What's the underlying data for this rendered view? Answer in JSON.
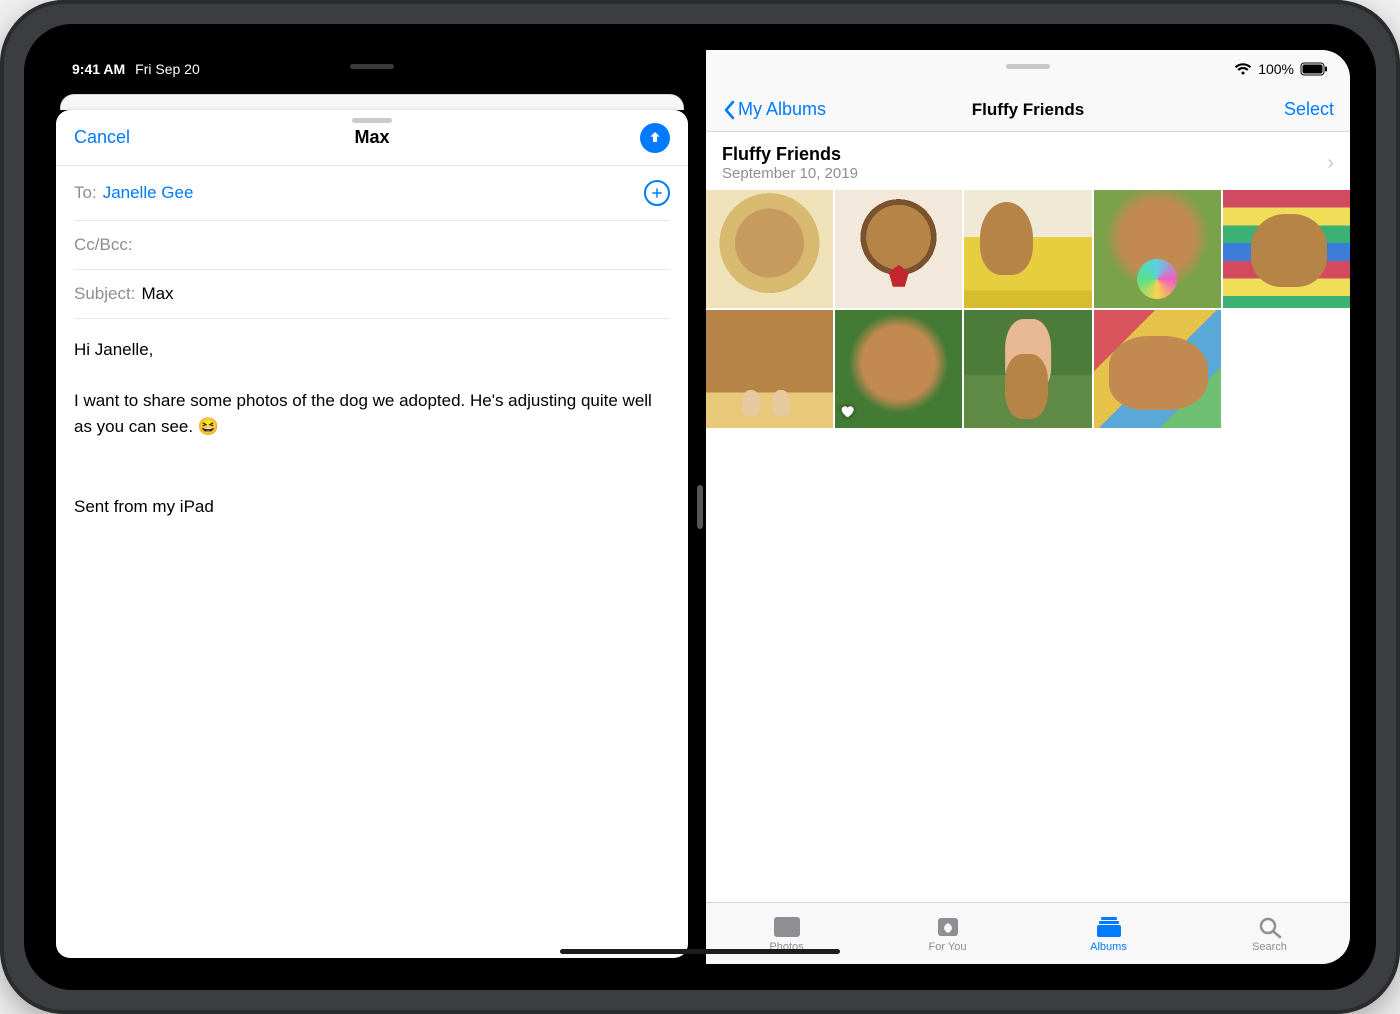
{
  "status": {
    "time": "9:41 AM",
    "date": "Fri Sep 20",
    "battery": "100%"
  },
  "mail": {
    "cancel": "Cancel",
    "title": "Max",
    "to_label": "To:",
    "to_value": "Janelle Gee",
    "ccbcc_label": "Cc/Bcc:",
    "subject_label": "Subject:",
    "subject_value": "Max",
    "body": "Hi Janelle,\n\nI want to share some photos of the dog we adopted. He's adjusting quite well as you can see. 😆",
    "signature": "Sent from my iPad"
  },
  "photos": {
    "back_label": "My Albums",
    "title": "Fluffy Friends",
    "select": "Select",
    "album": {
      "name": "Fluffy Friends",
      "date": "September 10, 2019"
    },
    "thumbs": [
      {
        "favorite": false
      },
      {
        "favorite": false
      },
      {
        "favorite": false
      },
      {
        "favorite": false
      },
      {
        "favorite": false
      },
      {
        "favorite": false
      },
      {
        "favorite": true
      },
      {
        "favorite": false
      },
      {
        "favorite": false
      }
    ],
    "tabs": {
      "photos": "Photos",
      "for_you": "For You",
      "albums": "Albums",
      "search": "Search"
    }
  }
}
